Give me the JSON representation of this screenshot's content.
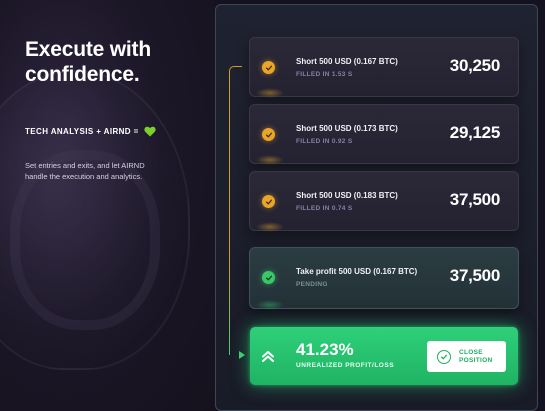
{
  "headline": "Execute with confidence.",
  "formula": {
    "text": "TECH ANALYSIS + AIRND =",
    "icon": "green-heart-icon"
  },
  "description": "Set entries and exits, and let AIRND handle the execution and analytics.",
  "orders": [
    {
      "title": "Short 500 USD (0.167 BTC)",
      "status": "FILLED IN 1.53 S",
      "price": "30,250",
      "icon": "checkmark-icon"
    },
    {
      "title": "Short 500 USD (0.173 BTC)",
      "status": "FILLED IN 0.92 S",
      "price": "29,125",
      "icon": "checkmark-icon"
    },
    {
      "title": "Short 500 USD (0.183 BTC)",
      "status": "FILLED IN 0.74 S",
      "price": "37,500",
      "icon": "checkmark-icon"
    },
    {
      "title": "Take profit 500 USD (0.167 BTC)",
      "status": "PENDING",
      "price": "37,500",
      "icon": "checkmark-icon"
    }
  ],
  "pnl": {
    "percent": "41.23%",
    "label": "UNREALIZED PROFIT/LOSS",
    "icon": "chevron-up-icon",
    "close_button": {
      "line1": "CLOSE",
      "line2": "POSITION",
      "icon": "check-circle-icon"
    }
  },
  "colors": {
    "filled_accent": "#e8a52a",
    "pending_accent": "#39c769",
    "pnl_green": "#2fd07a"
  }
}
